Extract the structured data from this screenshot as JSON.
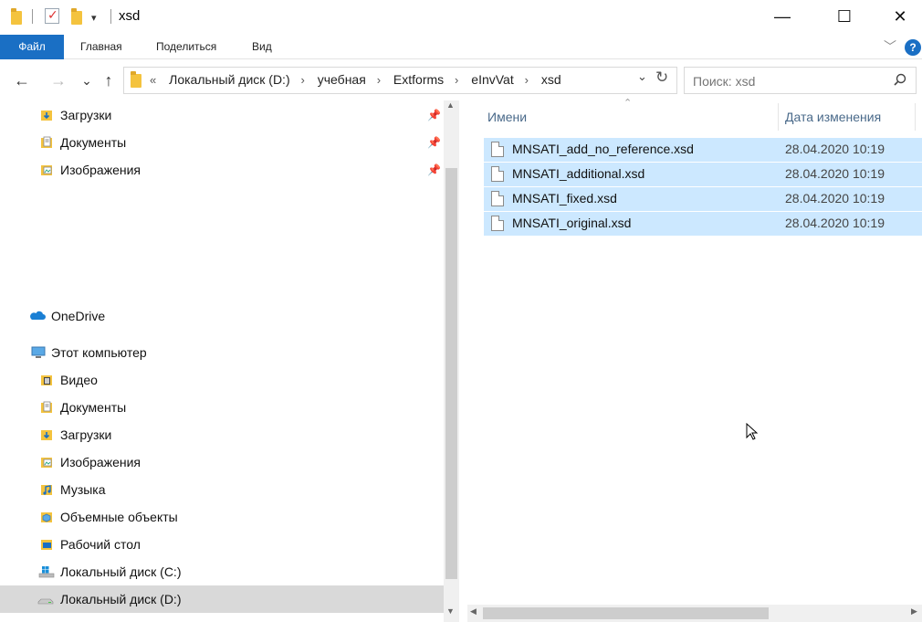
{
  "window": {
    "title": "xsd",
    "minimize_glyph": "—",
    "maximize_glyph": "☐",
    "close_glyph": "✕"
  },
  "quick_access": {
    "dropdown_glyph": "▾"
  },
  "ribbon": {
    "tabs": [
      {
        "label": "Файл",
        "active": true
      },
      {
        "label": "Главная"
      },
      {
        "label": "Поделиться"
      },
      {
        "label": "Вид"
      }
    ],
    "collapse_glyph": "﹀",
    "help_glyph": "?"
  },
  "navigation": {
    "back_glyph": "←",
    "forward_glyph": "→",
    "recent_glyph": "⌄",
    "up_glyph": "↑"
  },
  "address": {
    "overflow": "«",
    "separator": "›",
    "crumbs": [
      "Локальный диск (D:)",
      "учебная",
      "Extforms",
      "eInvVat",
      "xsd"
    ],
    "dropdown_glyph": "⌄",
    "refresh_glyph": "↻"
  },
  "search": {
    "placeholder": "Поиск: xsd"
  },
  "nav_pane": {
    "quick_items": [
      {
        "label": "Загрузки",
        "icon": "downloads-icon",
        "pinned": true
      },
      {
        "label": "Документы",
        "icon": "documents-icon",
        "pinned": true
      },
      {
        "label": "Изображения",
        "icon": "pictures-icon",
        "pinned": true
      }
    ],
    "pin_glyph": "📌",
    "onedrive": {
      "label": "OneDrive",
      "icon": "onedrive-icon"
    },
    "this_pc": {
      "label": "Этот компьютер",
      "icon": "computer-icon"
    },
    "pc_items": [
      {
        "label": "Видео",
        "icon": "video-icon"
      },
      {
        "label": "Документы",
        "icon": "documents-icon"
      },
      {
        "label": "Загрузки",
        "icon": "downloads-icon"
      },
      {
        "label": "Изображения",
        "icon": "pictures-icon"
      },
      {
        "label": "Музыка",
        "icon": "music-icon"
      },
      {
        "label": "Объемные объекты",
        "icon": "3d-objects-icon"
      },
      {
        "label": "Рабочий стол",
        "icon": "desktop-icon"
      },
      {
        "label": "Локальный диск (C:)",
        "icon": "windows-drive-icon"
      },
      {
        "label": "Локальный диск (D:)",
        "icon": "drive-icon",
        "selected": true
      }
    ]
  },
  "file_list": {
    "columns": {
      "name": "Имени",
      "date": "Дата изменения"
    },
    "sort_glyph": "⌃",
    "files": [
      {
        "name": "MNSATI_add_no_reference.xsd",
        "date": "28.04.2020 10:19",
        "selected": true
      },
      {
        "name": "MNSATI_additional.xsd",
        "date": "28.04.2020 10:19",
        "selected": true
      },
      {
        "name": "MNSATI_fixed.xsd",
        "date": "28.04.2020 10:19",
        "selected": true
      },
      {
        "name": "MNSATI_original.xsd",
        "date": "28.04.2020 10:19",
        "selected": true
      }
    ]
  },
  "colors": {
    "accent": "#1a6fc4",
    "selection": "#cce8ff",
    "nav_selected": "#d9d9d9",
    "folder": "#f4c33e"
  }
}
